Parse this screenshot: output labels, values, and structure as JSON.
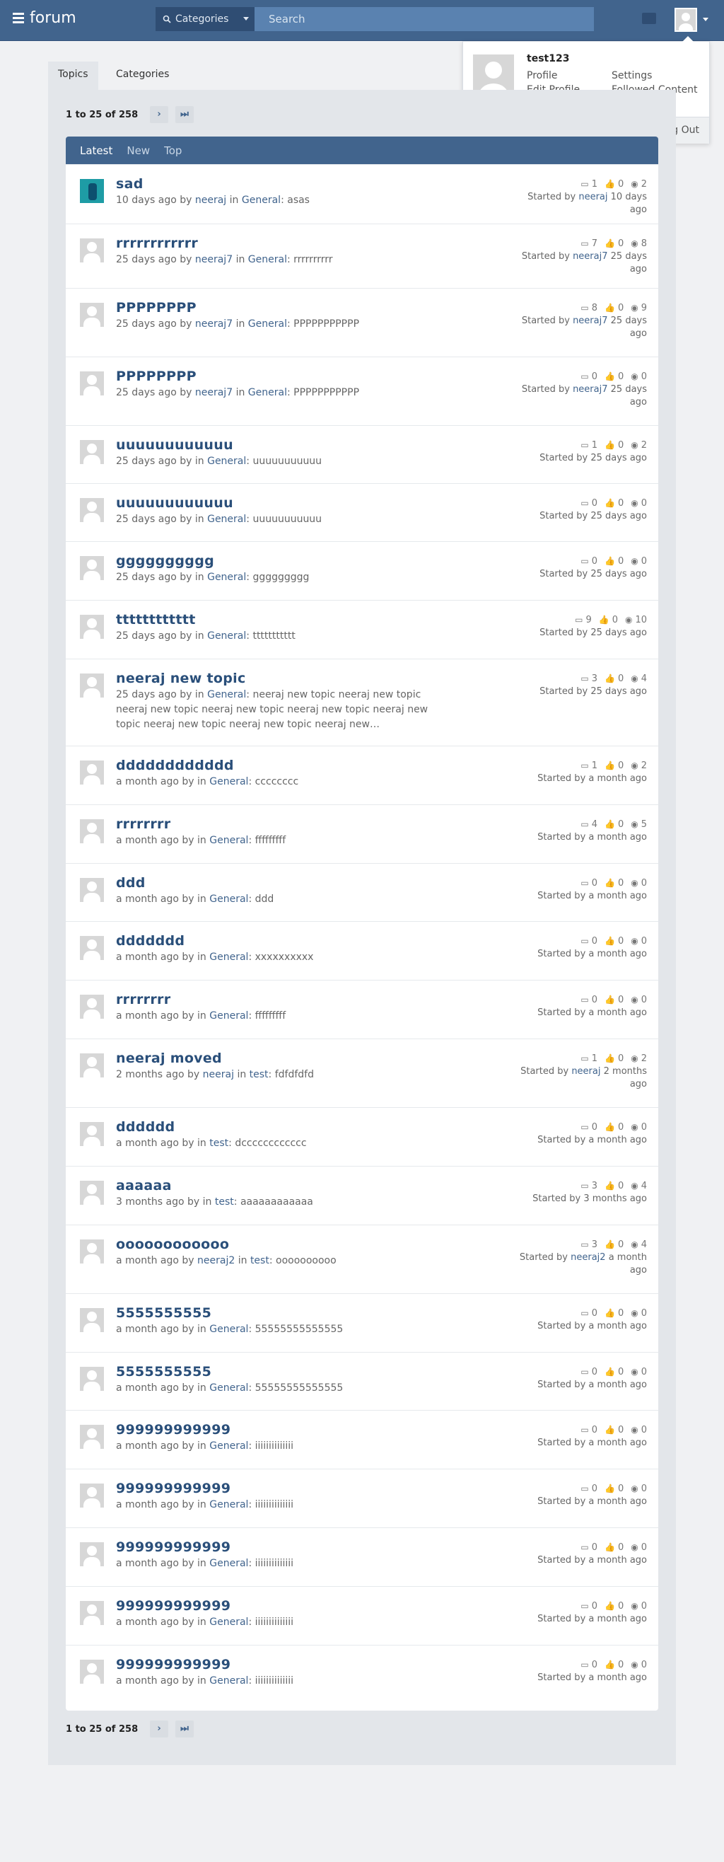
{
  "nav": {
    "brand": "forum",
    "categories_label": "Categories",
    "search_placeholder": "Search"
  },
  "dropdown": {
    "username": "test123",
    "profile": "Profile",
    "settings": "Settings",
    "edit_profile": "Edit Profile",
    "followed": "Followed Content",
    "logout": "Log Out"
  },
  "tabs": {
    "topics": "Topics",
    "categories": "Categories"
  },
  "pager": {
    "range": "1 to 25 of 258",
    "next": "›",
    "last": "⏭"
  },
  "list_tabs": {
    "latest": "Latest",
    "new": "New",
    "top": "Top"
  },
  "topics": [
    {
      "title": "sad",
      "age": "10 days ago",
      "user": "neeraj",
      "category": "General",
      "excerpt": "asas",
      "replies": "1",
      "likes": "0",
      "views": "2",
      "starter": "neeraj",
      "started_age": "10 days ago",
      "avatar": "image"
    },
    {
      "title": "rrrrrrrrrrrr",
      "age": "25 days ago",
      "user": "neeraj7",
      "category": "General",
      "excerpt": "rrrrrrrrrr",
      "replies": "7",
      "likes": "0",
      "views": "8",
      "starter": "neeraj7",
      "started_age": "25 days ago",
      "avatar": "default"
    },
    {
      "title": "PPPPPPPP",
      "age": "25 days ago",
      "user": "neeraj7",
      "category": "General",
      "excerpt": "PPPPPPPPPPP",
      "replies": "8",
      "likes": "0",
      "views": "9",
      "starter": "neeraj7",
      "started_age": "25 days ago",
      "avatar": "default"
    },
    {
      "title": "PPPPPPPP",
      "age": "25 days ago",
      "user": "neeraj7",
      "category": "General",
      "excerpt": "PPPPPPPPPPP",
      "replies": "0",
      "likes": "0",
      "views": "0",
      "starter": "neeraj7",
      "started_age": "25 days ago",
      "avatar": "default"
    },
    {
      "title": "uuuuuuuuuuuu",
      "age": "25 days ago",
      "user": "",
      "category": "General",
      "excerpt": "uuuuuuuuuuu",
      "replies": "1",
      "likes": "0",
      "views": "2",
      "starter": "",
      "started_age": "25 days ago",
      "avatar": "default"
    },
    {
      "title": "uuuuuuuuuuuu",
      "age": "25 days ago",
      "user": "",
      "category": "General",
      "excerpt": "uuuuuuuuuuu",
      "replies": "0",
      "likes": "0",
      "views": "0",
      "starter": "",
      "started_age": "25 days ago",
      "avatar": "default"
    },
    {
      "title": "gggggggggg",
      "age": "25 days ago",
      "user": "",
      "category": "General",
      "excerpt": "ggggggggg",
      "replies": "0",
      "likes": "0",
      "views": "0",
      "starter": "",
      "started_age": "25 days ago",
      "avatar": "default"
    },
    {
      "title": "tttttttttttt",
      "age": "25 days ago",
      "user": "",
      "category": "General",
      "excerpt": "ttttttttttt",
      "replies": "9",
      "likes": "0",
      "views": "10",
      "starter": "",
      "started_age": "25 days ago",
      "avatar": "default"
    },
    {
      "title": "neeraj new topic",
      "age": "25 days ago",
      "user": "",
      "category": "General",
      "excerpt": "neeraj new topic neeraj new topic neeraj new topic neeraj new topic neeraj new topic neeraj new topic neeraj new topic neeraj new topic neeraj new…",
      "replies": "3",
      "likes": "0",
      "views": "4",
      "starter": "",
      "started_age": "25 days ago",
      "avatar": "default"
    },
    {
      "title": "dddddddddddd",
      "age": "a month ago",
      "user": "",
      "category": "General",
      "excerpt": "cccccccc",
      "replies": "1",
      "likes": "0",
      "views": "2",
      "starter": "",
      "started_age": "a month ago",
      "avatar": "default"
    },
    {
      "title": "rrrrrrrr",
      "age": "a month ago",
      "user": "",
      "category": "General",
      "excerpt": "fffffffff",
      "replies": "4",
      "likes": "0",
      "views": "5",
      "starter": "",
      "started_age": "a month ago",
      "avatar": "default"
    },
    {
      "title": "ddd",
      "age": "a month ago",
      "user": "",
      "category": "General",
      "excerpt": "ddd",
      "replies": "0",
      "likes": "0",
      "views": "0",
      "starter": "",
      "started_age": "a month ago",
      "avatar": "default"
    },
    {
      "title": "ddddddd",
      "age": "a month ago",
      "user": "",
      "category": "General",
      "excerpt": "xxxxxxxxxx",
      "replies": "0",
      "likes": "0",
      "views": "0",
      "starter": "",
      "started_age": "a month ago",
      "avatar": "default"
    },
    {
      "title": "rrrrrrrr",
      "age": "a month ago",
      "user": "",
      "category": "General",
      "excerpt": "fffffffff",
      "replies": "0",
      "likes": "0",
      "views": "0",
      "starter": "",
      "started_age": "a month ago",
      "avatar": "default"
    },
    {
      "title": "neeraj moved",
      "age": "2 months ago",
      "user": "neeraj",
      "category": "test",
      "excerpt": "fdfdfdfd",
      "replies": "1",
      "likes": "0",
      "views": "2",
      "starter": "neeraj",
      "started_age": "2 months ago",
      "avatar": "default"
    },
    {
      "title": "dddddd",
      "age": "a month ago",
      "user": "",
      "category": "test",
      "excerpt": "dcccccccccccc",
      "replies": "0",
      "likes": "0",
      "views": "0",
      "starter": "",
      "started_age": "a month ago",
      "avatar": "default"
    },
    {
      "title": "aaaaaa",
      "age": "3 months ago",
      "user": "",
      "category": "test",
      "excerpt": "aaaaaaaaaaaa",
      "replies": "3",
      "likes": "0",
      "views": "4",
      "starter": "",
      "started_age": "3 months ago",
      "avatar": "default"
    },
    {
      "title": "oooooooooooo",
      "age": "a month ago",
      "user": "neeraj2",
      "category": "test",
      "excerpt": "oooooooooo",
      "replies": "3",
      "likes": "0",
      "views": "4",
      "starter": "neeraj2",
      "started_age": "a month ago",
      "avatar": "default"
    },
    {
      "title": "5555555555",
      "age": "a month ago",
      "user": "",
      "category": "General",
      "excerpt": "55555555555555",
      "replies": "0",
      "likes": "0",
      "views": "0",
      "starter": "",
      "started_age": "a month ago",
      "avatar": "default"
    },
    {
      "title": "5555555555",
      "age": "a month ago",
      "user": "",
      "category": "General",
      "excerpt": "55555555555555",
      "replies": "0",
      "likes": "0",
      "views": "0",
      "starter": "",
      "started_age": "a month ago",
      "avatar": "default"
    },
    {
      "title": "999999999999",
      "age": "a month ago",
      "user": "",
      "category": "General",
      "excerpt": "iiiiiiiiiiiiii",
      "replies": "0",
      "likes": "0",
      "views": "0",
      "starter": "",
      "started_age": "a month ago",
      "avatar": "default"
    },
    {
      "title": "999999999999",
      "age": "a month ago",
      "user": "",
      "category": "General",
      "excerpt": "iiiiiiiiiiiiii",
      "replies": "0",
      "likes": "0",
      "views": "0",
      "starter": "",
      "started_age": "a month ago",
      "avatar": "default"
    },
    {
      "title": "999999999999",
      "age": "a month ago",
      "user": "",
      "category": "General",
      "excerpt": "iiiiiiiiiiiiii",
      "replies": "0",
      "likes": "0",
      "views": "0",
      "starter": "",
      "started_age": "a month ago",
      "avatar": "default"
    },
    {
      "title": "999999999999",
      "age": "a month ago",
      "user": "",
      "category": "General",
      "excerpt": "iiiiiiiiiiiiii",
      "replies": "0",
      "likes": "0",
      "views": "0",
      "starter": "",
      "started_age": "a month ago",
      "avatar": "default"
    },
    {
      "title": "999999999999",
      "age": "a month ago",
      "user": "",
      "category": "General",
      "excerpt": "iiiiiiiiiiiiii",
      "replies": "0",
      "likes": "0",
      "views": "0",
      "starter": "",
      "started_age": "a month ago",
      "avatar": "default"
    }
  ]
}
